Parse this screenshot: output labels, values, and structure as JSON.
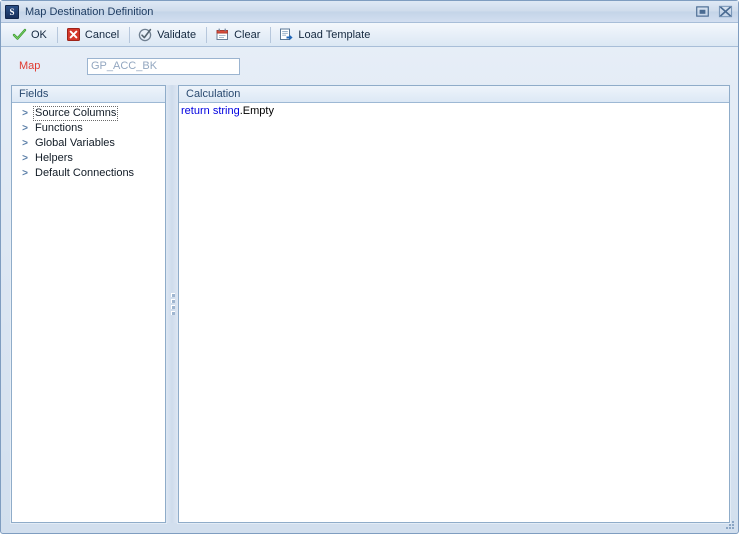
{
  "window": {
    "title": "Map Destination Definition",
    "app_icon": "S",
    "controls": [
      {
        "name": "maximize-button",
        "icon": "maximize-icon",
        "label": "Maximize"
      },
      {
        "name": "close-button",
        "icon": "close-icon",
        "label": "Close"
      }
    ]
  },
  "toolbar": {
    "items": [
      {
        "label": "OK",
        "icon": "check-icon",
        "name": "ok-button"
      },
      {
        "label": "Cancel",
        "icon": "cancel-icon",
        "name": "cancel-button"
      },
      {
        "label": "Validate",
        "icon": "validate-icon",
        "name": "validate-button"
      },
      {
        "label": "Clear",
        "icon": "clear-icon",
        "name": "clear-button"
      },
      {
        "label": "Load Template",
        "icon": "load-template-icon",
        "name": "load-template-button"
      }
    ]
  },
  "form": {
    "map_label": "Map",
    "map_value": "GP_ACC_BK",
    "map_placeholder": "GP_ACC_BK"
  },
  "fields_panel": {
    "header": "Fields",
    "nodes": [
      {
        "label": "Source Columns",
        "expander": ">",
        "selected": true
      },
      {
        "label": "Functions",
        "expander": ">",
        "selected": false
      },
      {
        "label": "Global Variables",
        "expander": ">",
        "selected": false
      },
      {
        "label": "Helpers",
        "expander": ">",
        "selected": false
      },
      {
        "label": "Default Connections",
        "expander": ">",
        "selected": false
      }
    ]
  },
  "calculation_panel": {
    "header": "Calculation",
    "code": {
      "keyword1": "return",
      "space": " ",
      "keyword2": "string",
      "rest": ".Empty"
    }
  },
  "colors": {
    "required_label": "#e03a30",
    "keyword": "#0000e0",
    "window_chrome": "#d2dfee",
    "panel_border": "#8facc9",
    "accent_ok": "#2aa02a",
    "accent_cancel": "#cc2b20"
  }
}
